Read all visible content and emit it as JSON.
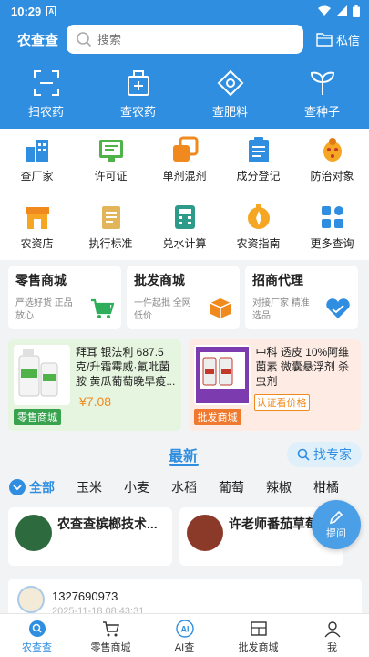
{
  "status": {
    "time": "10:29"
  },
  "header": {
    "brand": "农查查",
    "search_placeholder": "搜索",
    "msg": "私信"
  },
  "quick": [
    {
      "label": "扫农药",
      "icon": "scan-icon"
    },
    {
      "label": "查农药",
      "icon": "pesticide-bottle-icon"
    },
    {
      "label": "查肥料",
      "icon": "fertilizer-bag-icon"
    },
    {
      "label": "查种子",
      "icon": "sprout-icon"
    }
  ],
  "grid": [
    {
      "label": "查厂家",
      "icon": "factory-icon"
    },
    {
      "label": "许可证",
      "icon": "license-icon"
    },
    {
      "label": "单剂混剂",
      "icon": "mix-icon"
    },
    {
      "label": "成分登记",
      "icon": "register-icon"
    },
    {
      "label": "防治对象",
      "icon": "bug-icon"
    },
    {
      "label": "农资店",
      "icon": "store-icon"
    },
    {
      "label": "执行标准",
      "icon": "standard-icon"
    },
    {
      "label": "兑水计算",
      "icon": "calculator-icon"
    },
    {
      "label": "农资指南",
      "icon": "compass-icon"
    },
    {
      "label": "更多查询",
      "icon": "more-grid-icon"
    }
  ],
  "shops": [
    {
      "title": "零售商城",
      "sub": "严选好货 正品放心",
      "icon": "cart-icon",
      "color": "#2eae5a"
    },
    {
      "title": "批发商城",
      "sub": "一件起批 全网低价",
      "icon": "box-icon",
      "color": "#f08a1e"
    },
    {
      "title": "招商代理",
      "sub": "对接厂家 精准选品",
      "icon": "handshake-icon",
      "color": "#2f8ee0"
    }
  ],
  "products": [
    {
      "name": "拜耳 银法利 687.5克/升霜霉威·氟吡菌胺 黄瓜葡萄晚早疫...",
      "price": "¥7.08",
      "tag": "零售商城"
    },
    {
      "name": "中科 透皮 10%阿维菌素 微囊悬浮剂 杀虫剂",
      "verify": "认证看价格",
      "tag": "批发商城"
    }
  ],
  "latest": {
    "title": "最新",
    "expert": "找专家"
  },
  "categories": {
    "all": "全部",
    "items": [
      "玉米",
      "小麦",
      "水稻",
      "葡萄",
      "辣椒",
      "柑橘"
    ]
  },
  "feeds": [
    {
      "title": "农查查槟榔技术..."
    },
    {
      "title": "许老师番茄草莓..."
    }
  ],
  "float_button": {
    "label": "提问"
  },
  "post": {
    "name": "1327690973",
    "time": "2025-11-18 08:43:31"
  },
  "tabbar": [
    {
      "label": "农查查",
      "icon": "home-icon",
      "active": true
    },
    {
      "label": "零售商城",
      "icon": "cart-icon"
    },
    {
      "label": "AI查",
      "icon": "ai-icon"
    },
    {
      "label": "批发商城",
      "icon": "wholesale-icon"
    },
    {
      "label": "我",
      "icon": "user-icon"
    }
  ],
  "colors": {
    "primary": "#2f8ee0",
    "price": "#f08a1e"
  }
}
